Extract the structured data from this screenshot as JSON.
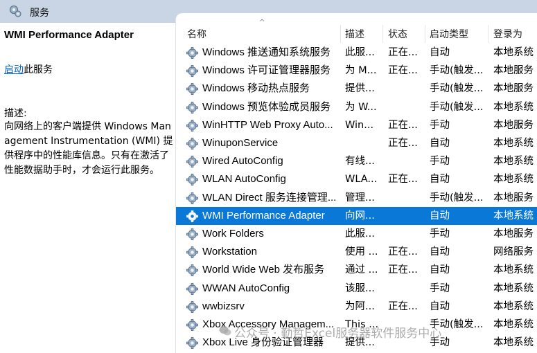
{
  "window": {
    "title": "服务"
  },
  "left_panel": {
    "service_name": "WMI Performance Adapter",
    "action_link": "启动",
    "action_suffix": "此服务",
    "description_label": "描述:",
    "description_text": "向网络上的客户端提供 Windows Management Instrumentation (WMI) 提供程序中的性能库信息。只有在激活了性能数据助手时，才会运行此服务。"
  },
  "columns": {
    "name": "名称",
    "description": "描述",
    "status": "状态",
    "startup_type": "启动类型",
    "logon_as": "登录为"
  },
  "rows": [
    {
      "name": "Windows 推送通知系统服务",
      "description": "此服...",
      "status": "正在...",
      "startup_type": "自动",
      "logon_as": "本地系统"
    },
    {
      "name": "Windows 许可证管理器服务",
      "description": "为 M...",
      "status": "正在...",
      "startup_type": "手动(触发...",
      "logon_as": "本地服务"
    },
    {
      "name": "Windows 移动热点服务",
      "description": "提供...",
      "status": "",
      "startup_type": "手动(触发...",
      "logon_as": "本地服务"
    },
    {
      "name": "Windows 预览体验成员服务",
      "description": "为 W...",
      "status": "",
      "startup_type": "手动(触发...",
      "logon_as": "本地系统"
    },
    {
      "name": "WinHTTP Web Proxy Auto...",
      "description": "Win...",
      "status": "正在...",
      "startup_type": "手动",
      "logon_as": "本地服务"
    },
    {
      "name": "WinuponService",
      "description": "",
      "status": "正在...",
      "startup_type": "自动",
      "logon_as": "本地系统"
    },
    {
      "name": "Wired AutoConfig",
      "description": "有线...",
      "status": "",
      "startup_type": "手动",
      "logon_as": "本地系统"
    },
    {
      "name": "WLAN AutoConfig",
      "description": "WLA...",
      "status": "正在...",
      "startup_type": "自动",
      "logon_as": "本地系统"
    },
    {
      "name": "WLAN Direct 服务连接管理...",
      "description": "管理...",
      "status": "",
      "startup_type": "手动(触发...",
      "logon_as": "本地服务"
    },
    {
      "name": "WMI Performance Adapter",
      "description": "向网...",
      "status": "",
      "startup_type": "自动",
      "logon_as": "本地系统",
      "selected": true
    },
    {
      "name": "Work Folders",
      "description": "此服...",
      "status": "",
      "startup_type": "手动",
      "logon_as": "本地服务"
    },
    {
      "name": "Workstation",
      "description": "使用 ...",
      "status": "正在...",
      "startup_type": "自动",
      "logon_as": "网络服务"
    },
    {
      "name": "World Wide Web 发布服务",
      "description": "通过 ...",
      "status": "正在...",
      "startup_type": "自动",
      "logon_as": "本地系统"
    },
    {
      "name": "WWAN AutoConfig",
      "description": "该服...",
      "status": "",
      "startup_type": "手动",
      "logon_as": "本地系统"
    },
    {
      "name": "wwbizsrv",
      "description": "为阿...",
      "status": "正在...",
      "startup_type": "自动",
      "logon_as": "本地系统"
    },
    {
      "name": "Xbox Accessory Managem...",
      "description": "This ...",
      "status": "",
      "startup_type": "手动(触发...",
      "logon_as": "本地系统"
    },
    {
      "name": "Xbox Live 身份验证管理器",
      "description": "提供...",
      "status": "",
      "startup_type": "手动",
      "logon_as": "本地系统"
    }
  ],
  "watermark": "公众号 · 勤哲Excel服务器软件服务中心",
  "icons": {
    "title": "services-gear-icon",
    "row": "service-gear-icon"
  },
  "colors": {
    "selection": "#0a78d7",
    "link": "#0563c1",
    "titlebar": "#c9d4e4"
  }
}
